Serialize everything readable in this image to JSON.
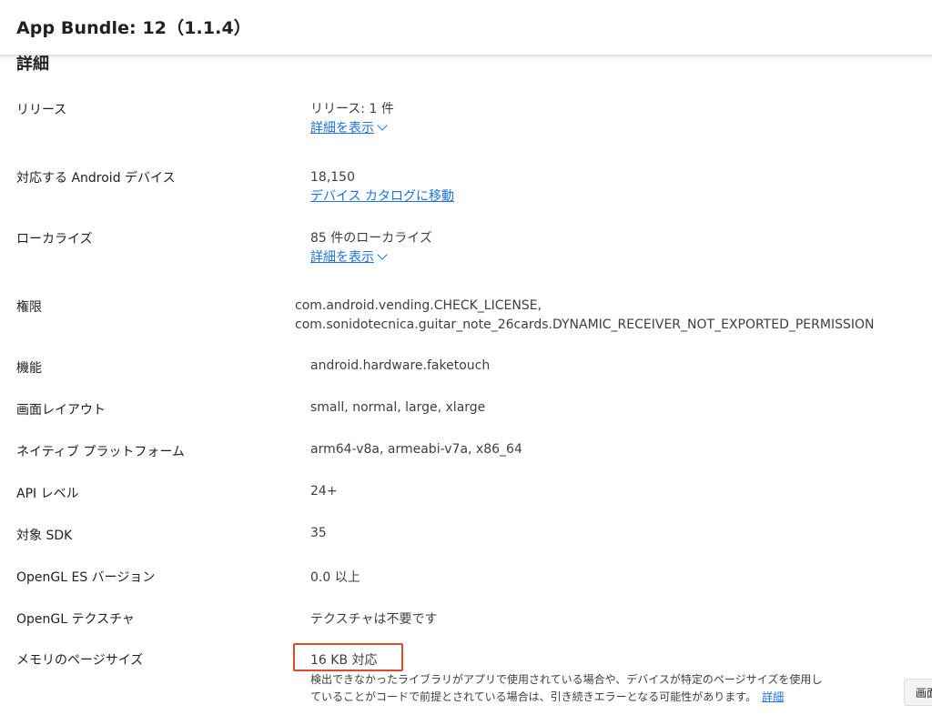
{
  "header": {
    "title": "App Bundle: 12（1.1.4）"
  },
  "section": {
    "heading": "詳細"
  },
  "rows": {
    "release": {
      "label": "リリース",
      "value": "リリース: 1 件",
      "link": "詳細を表示"
    },
    "devices": {
      "label": "対応する Android デバイス",
      "value": "18,150",
      "link": "デバイス カタログに移動"
    },
    "localize": {
      "label": "ローカライズ",
      "value": "85 件のローカライズ",
      "link": "詳細を表示"
    },
    "permissions": {
      "label": "権限",
      "values": [
        "com.android.vending.CHECK_LICENSE,",
        "com.sonidotecnica.guitar_note_26cards.DYNAMIC_RECEIVER_NOT_EXPORTED_PERMISSION"
      ]
    },
    "features": {
      "label": "機能",
      "value": "android.hardware.faketouch"
    },
    "screen_layout": {
      "label": "画面レイアウト",
      "value": "small, normal, large, xlarge"
    },
    "native_platform": {
      "label": "ネイティブ プラットフォーム",
      "value": "arm64-v8a, armeabi-v7a, x86_64"
    },
    "api_level": {
      "label": "API レベル",
      "value": "24+"
    },
    "target_sdk": {
      "label": "対象 SDK",
      "value": "35"
    },
    "opengl_es": {
      "label": "OpenGL ES バージョン",
      "value": "0.0 以上"
    },
    "opengl_texture": {
      "label": "OpenGL テクスチャ",
      "value": "テクスチャは不要です"
    },
    "memory_page": {
      "label": "メモリのページサイズ",
      "value": "16 KB 対応",
      "note_line1": "検出できなかったライブラリがアプリで使用されている場合や、デバイスが特定のページサイズを使用し",
      "note_line2": "ていることがコードで前提とされている場合は、引き続きエラーとなる可能性があります。",
      "note_link": "詳細"
    }
  },
  "side_button": {
    "label": "画面"
  },
  "colors": {
    "link": "#1a73e8",
    "highlight": "#e2492b"
  }
}
